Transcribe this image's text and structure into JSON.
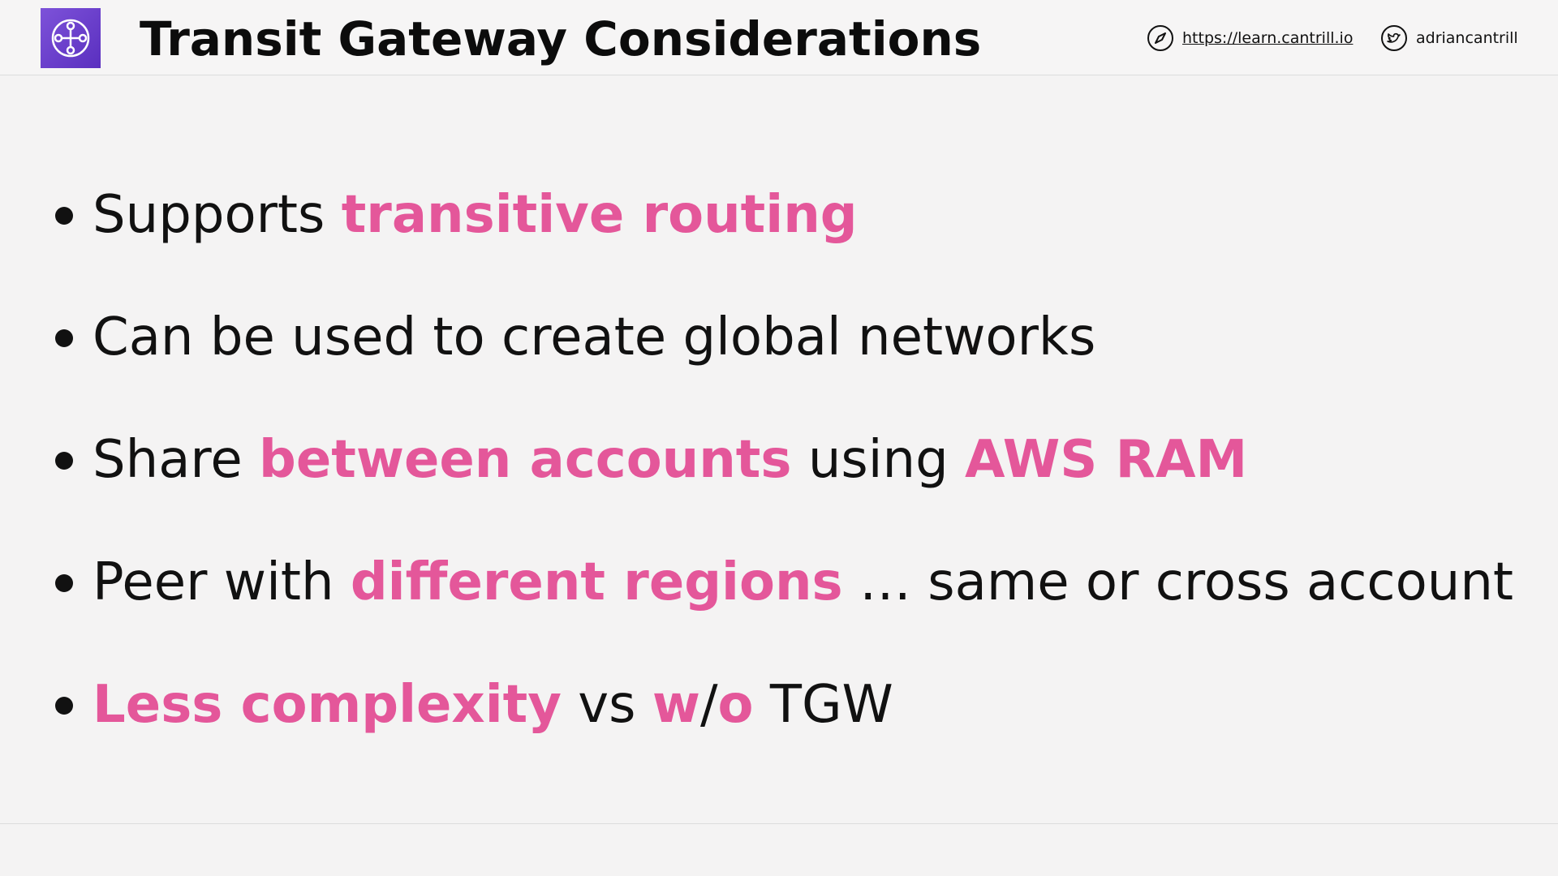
{
  "header": {
    "title": "Transit Gateway Considerations",
    "logo_icon": "transit-gateway-icon",
    "site_link": "https://learn.cantrill.io",
    "site_icon": "compass-icon",
    "twitter_handle": "adriancantrill",
    "twitter_icon": "twitter-icon"
  },
  "colors": {
    "highlight": "#e4579a",
    "logo_purple": "#6a3fcf",
    "text": "#111111",
    "background": "#f4f3f3"
  },
  "bullets": [
    {
      "segments": [
        {
          "text": "Supports ",
          "highlight": false
        },
        {
          "text": "transitive routing",
          "highlight": true
        }
      ]
    },
    {
      "segments": [
        {
          "text": "Can be used to create global networks",
          "highlight": false
        }
      ]
    },
    {
      "segments": [
        {
          "text": "Share ",
          "highlight": false
        },
        {
          "text": "between accounts",
          "highlight": true
        },
        {
          "text": " using ",
          "highlight": false
        },
        {
          "text": "AWS RAM",
          "highlight": true
        }
      ]
    },
    {
      "segments": [
        {
          "text": "Peer with ",
          "highlight": false
        },
        {
          "text": "different regions",
          "highlight": true
        },
        {
          "text": " … same or cross account",
          "highlight": false
        }
      ]
    },
    {
      "segments": [
        {
          "text": "Less complexity",
          "highlight": true
        },
        {
          "text": " vs ",
          "highlight": false
        },
        {
          "text": "w",
          "highlight": true
        },
        {
          "text": "/",
          "highlight": false
        },
        {
          "text": "o",
          "highlight": true
        },
        {
          "text": " TGW",
          "highlight": false
        }
      ]
    }
  ]
}
